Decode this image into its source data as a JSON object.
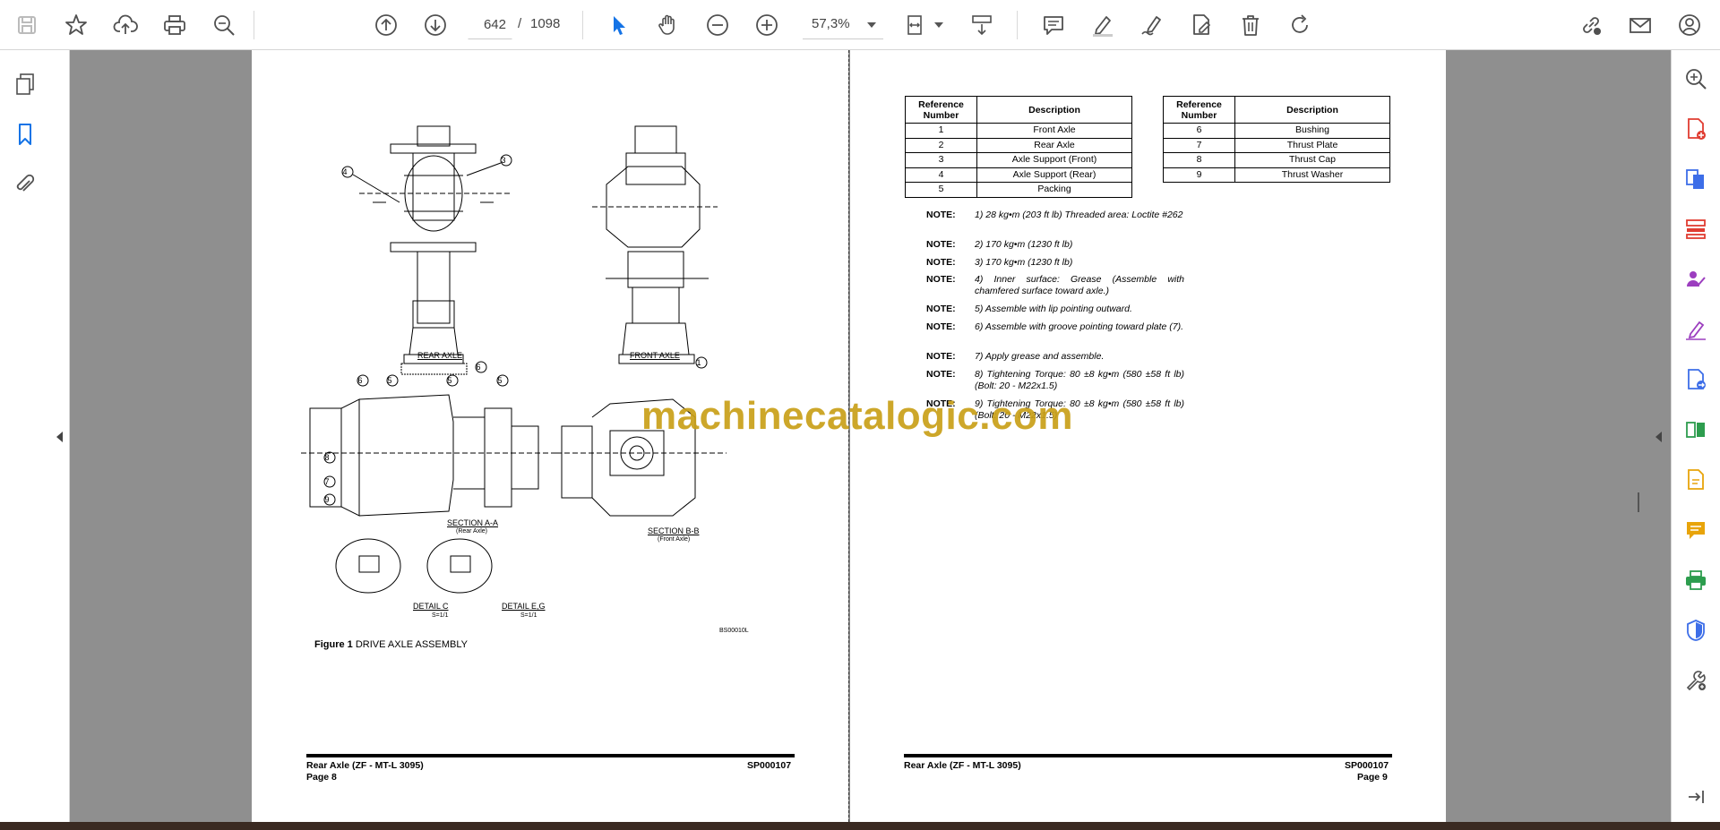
{
  "toolbar": {
    "page_current": "642",
    "page_separator": "/",
    "page_total": "1098",
    "zoom": "57,3%"
  },
  "colors": {
    "accent_blue": "#1473e6",
    "icon_gray": "#505050",
    "sidebar_red": "#e03c31",
    "sidebar_blue": "#3d6ee8",
    "sidebar_purple": "#9c3ebf",
    "sidebar_yellow": "#e8a40a",
    "sidebar_green": "#2d9d4e",
    "watermark": "#c9a018"
  },
  "left_page": {
    "drawing_labels": {
      "rear_axle": "REAR AXLE",
      "front_axle": "FRONT AXLE",
      "section_aa": "SECTION A-A",
      "section_aa_sub": "(Rear Axle)",
      "section_bb": "SECTION B-B",
      "section_bb_sub": "(Front Axle)",
      "detail_c": "DETAIL C",
      "detail_c_sub": "S=1/1",
      "detail_eg": "DETAIL E,G",
      "detail_eg_sub": "S=1/1",
      "drawing_code": "BS00010L"
    },
    "figure_caption_bold": "Figure 1",
    "figure_caption_text": "DRIVE AXLE ASSEMBLY",
    "footer_title": "Rear Axle (ZF - MT-L 3095)",
    "footer_code": "SP000107",
    "footer_page": "Page 8"
  },
  "right_page": {
    "table_headers": {
      "ref": "Reference Number",
      "desc": "Description"
    },
    "table_left": [
      {
        "ref": "1",
        "desc": "Front Axle"
      },
      {
        "ref": "2",
        "desc": "Rear Axle"
      },
      {
        "ref": "3",
        "desc": "Axle Support (Front)"
      },
      {
        "ref": "4",
        "desc": "Axle Support (Rear)"
      },
      {
        "ref": "5",
        "desc": "Packing"
      }
    ],
    "table_right": [
      {
        "ref": "6",
        "desc": "Bushing"
      },
      {
        "ref": "7",
        "desc": "Thrust Plate"
      },
      {
        "ref": "8",
        "desc": "Thrust Cap"
      },
      {
        "ref": "9",
        "desc": "Thrust Washer"
      }
    ],
    "note_label": "NOTE:",
    "notes": [
      "1) 28 kg•m (203 ft lb) Threaded area: Loctite #262",
      "2) 170 kg•m (1230 ft lb)",
      "3) 170 kg•m (1230 ft lb)",
      "4) Inner surface: Grease (Assemble with chamfered surface toward axle.)",
      "5) Assemble with lip pointing outward.",
      "6) Assemble with groove pointing toward plate (7).",
      "7) Apply grease and assemble.",
      "8) Tightening Torque: 80 ±8 kg•m (580 ±58 ft lb) (Bolt: 20 - M22x1.5)",
      "9) Tightening Torque: 80 ±8 kg•m (580 ±58 ft lb) (Bolt: 20 - M22x1.5)"
    ],
    "footer_title": "Rear Axle (ZF - MT-L 3095)",
    "footer_code": "SP000107",
    "footer_page": "Page 9"
  },
  "watermark": "machinecatalogic.com"
}
